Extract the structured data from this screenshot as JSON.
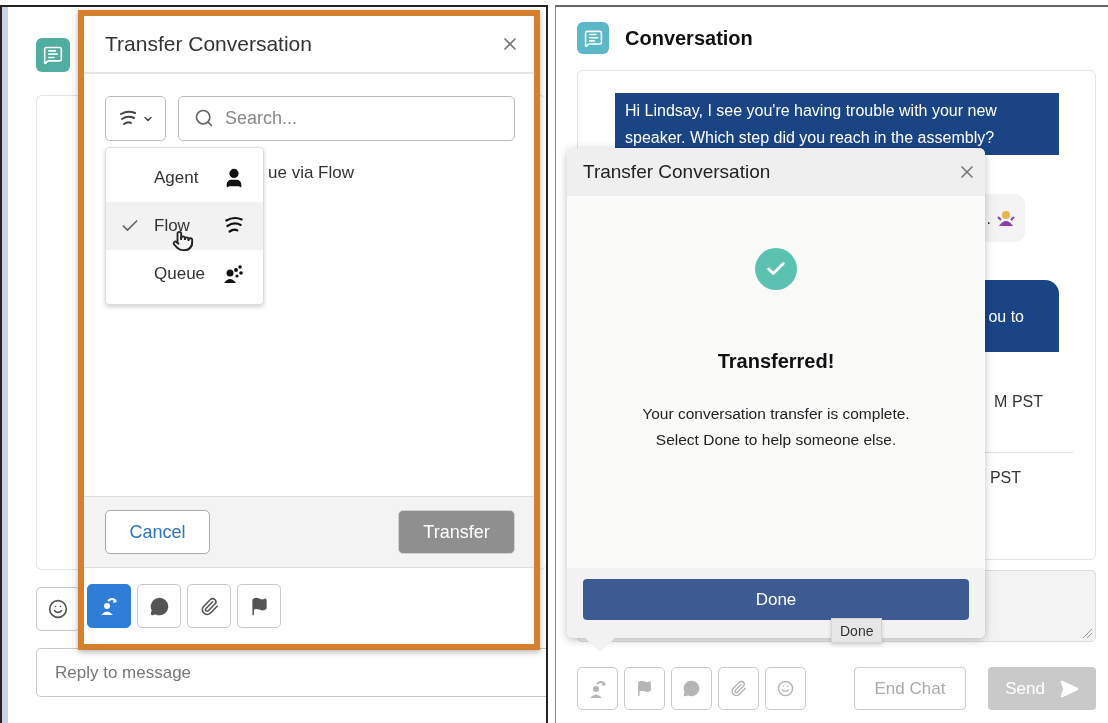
{
  "left_screen": {
    "reply_field": {
      "placeholder": "Reply to message"
    },
    "dialog": {
      "title": "Transfer Conversation",
      "search": {
        "placeholder": "Search..."
      },
      "menu": [
        {
          "label": "Agent",
          "kind": "agent",
          "selected": false
        },
        {
          "label": "Flow",
          "kind": "flow",
          "selected": true
        },
        {
          "label": "Queue",
          "kind": "queue",
          "selected": false
        }
      ],
      "partial_result": "ue via Flow",
      "buttons": [
        {
          "label": "Cancel",
          "disabled": false
        },
        {
          "label": "Transfer",
          "disabled": true
        }
      ],
      "toolbar": [
        {
          "kind": "transfer",
          "selected": true
        },
        {
          "kind": "chat",
          "selected": false
        },
        {
          "kind": "link",
          "selected": false
        },
        {
          "kind": "flag",
          "selected": false
        }
      ]
    }
  },
  "right_screen": {
    "title": "Conversation",
    "messages": [
      {
        "kind": "outgoing",
        "text": "Hi Lindsay, I see you're having trouble with your new speaker. Which step did you reach in the assembly?"
      },
      {
        "kind": "incoming",
        "text": "."
      },
      {
        "kind": "outgoing",
        "text": "ou to"
      }
    ],
    "timestamps": [
      "M PST",
      "PST"
    ],
    "toolbar": [
      {
        "kind": "transfer",
        "selected": false
      },
      {
        "kind": "flag",
        "selected": false
      },
      {
        "kind": "chat",
        "selected": false
      },
      {
        "kind": "link",
        "selected": false
      },
      {
        "kind": "emoji",
        "selected": false
      }
    ],
    "end_chat": {
      "label": "End Chat",
      "disabled": true
    },
    "send": {
      "label": "Send",
      "disabled": true
    },
    "popover": {
      "title": "Transfer Conversation",
      "heading": "Transferred!",
      "message": "Your conversation transfer is complete.\nSelect Done to help someone else.",
      "button": "Done",
      "tooltip": "Done"
    }
  }
}
